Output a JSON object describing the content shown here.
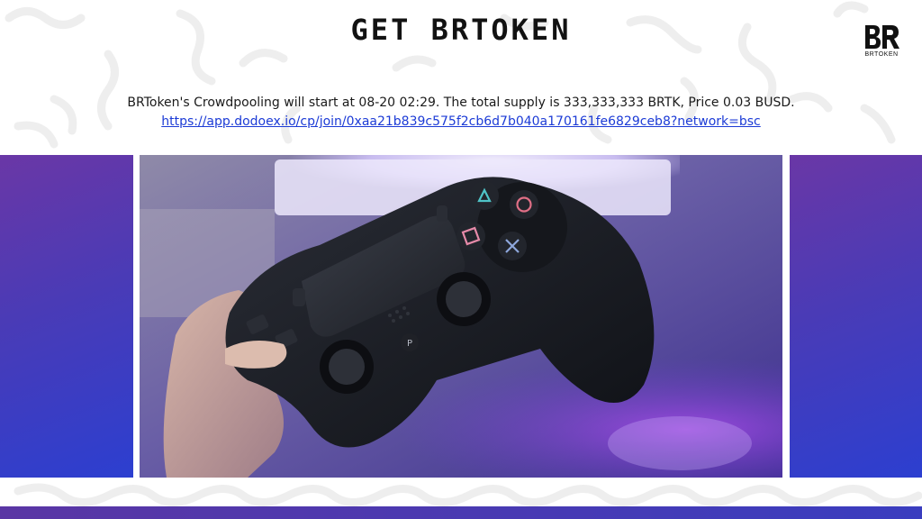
{
  "page": {
    "title": "GET BRTOKEN",
    "logo_text": "BRTOKEN",
    "info_text": "BRToken's Crowdpooling will start at 08-20 02:29. The total supply is 333,333,333 BRTK, Price 0.03 BUSD.",
    "link_text": "https://app.dodoex.io/cp/join/0xaa21b839c575f2cb6d7b040a170161fe6829ceb8?network=bsc"
  },
  "colors": {
    "accent_purple": "#6a37a6",
    "accent_blue": "#2c3fd0",
    "link": "#1c3bd6",
    "title": "#121212"
  }
}
